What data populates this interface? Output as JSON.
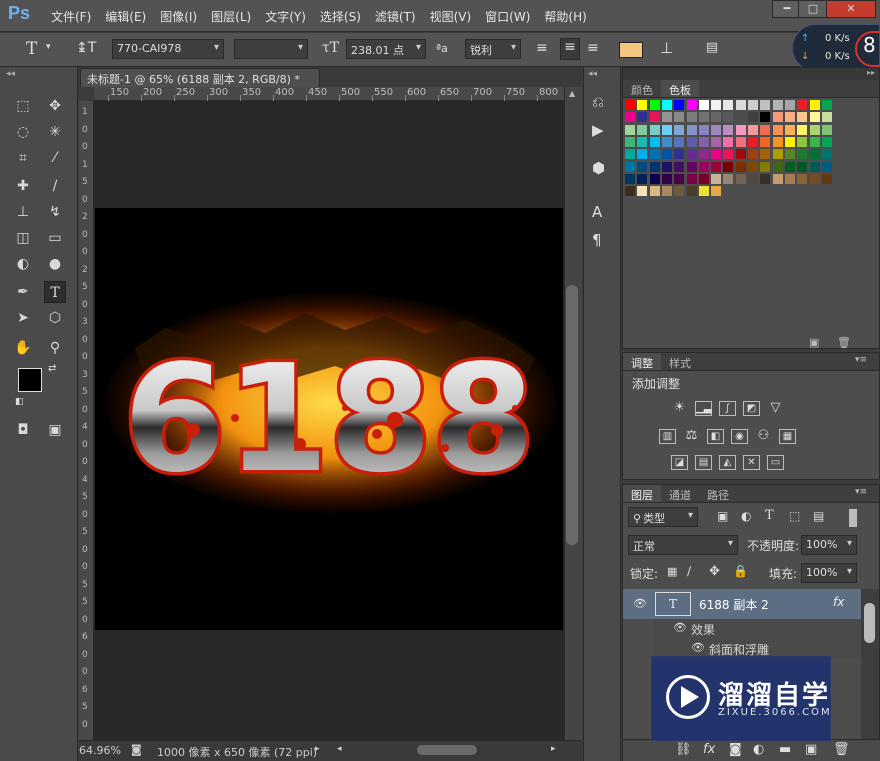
{
  "app": {
    "logo": "Ps"
  },
  "menu": [
    "文件(F)",
    "编辑(E)",
    "图像(I)",
    "图层(L)",
    "文字(Y)",
    "选择(S)",
    "滤镜(T)",
    "视图(V)",
    "窗口(W)",
    "帮助(H)"
  ],
  "window_controls": {
    "minimize": "━",
    "maximize": "□",
    "close": "✕"
  },
  "options_bar": {
    "tool_glyph": "T",
    "font_family": "770-CAI978",
    "font_size": "238.01 点",
    "antialias_glyph": "ªa",
    "antialias": "锐利",
    "swatch_color": "#f5c77e"
  },
  "net_widget": {
    "up": "0 K/s",
    "down": "0 K/s",
    "badge": "8"
  },
  "document": {
    "tab_title": "未标题-1 @ 65% (6188 副本 2, RGB/8) *",
    "close": "×",
    "ruler_h": [
      "150",
      "200",
      "250",
      "300",
      "350",
      "400",
      "450",
      "500",
      "550",
      "600",
      "650",
      "700",
      "750",
      "800"
    ],
    "ruler_v": [
      "1",
      "0",
      "0",
      "1",
      "5",
      "0",
      "2",
      "0",
      "0",
      "2",
      "5",
      "0",
      "3",
      "0",
      "0",
      "3",
      "5",
      "0",
      "4",
      "0",
      "0",
      "4",
      "5",
      "0",
      "5",
      "0",
      "0",
      "5",
      "5",
      "0",
      "6",
      "0",
      "0",
      "6",
      "5",
      "0"
    ],
    "text": "6188",
    "colors": {
      "fire": "#ffb020",
      "ember": "#c81e0a",
      "steel": "#e8e8e8"
    }
  },
  "status": {
    "zoom": "64.96%",
    "info": "1000 像素 x 650 像素 (72 ppi)"
  },
  "swatches_panel": {
    "tabs": [
      "颜色",
      "色板"
    ],
    "active": "色板",
    "rows": [
      [
        "#ff0000",
        "#ffff00",
        "#00ff00",
        "#00ffff",
        "#0000ff",
        "#ff00ff",
        "#ffffff",
        "#f2f2f2",
        "#e6e6e6",
        "#d9d9d9",
        "#cccccc",
        "#bfbfbf",
        "#b3b3b3",
        "#a6a6a6",
        "#ed1c24",
        "#fff200",
        "#00a650"
      ],
      [
        "#ec008c",
        "#2e3192",
        "#ed145b",
        "#949494",
        "#898989",
        "#7d7d7d",
        "#737373",
        "#666666",
        "#595959",
        "#4d4d4d",
        "#404040",
        "#000000",
        "#f7977a",
        "#f9ad81",
        "#fdc68a",
        "#fff79a",
        "#c4df9b"
      ],
      [
        "#a3d39c",
        "#82ca9d",
        "#7bcdc8",
        "#6ecff6",
        "#7ea7d8",
        "#8493ca",
        "#8882be",
        "#a187be",
        "#bc8dbf",
        "#f49ac2",
        "#f6989d",
        "#f26c4f",
        "#f68e55",
        "#fbaf5c",
        "#fff467",
        "#acd372",
        "#7dc473"
      ],
      [
        "#3bb878",
        "#1abbb4",
        "#00bff3",
        "#438ccb",
        "#5574b9",
        "#605ca8",
        "#855fa8",
        "#a763a8",
        "#f06eaa",
        "#f26d7d",
        "#ed1c24",
        "#f26522",
        "#f7941d",
        "#fff200",
        "#8dc73f",
        "#39b54a",
        "#00a651"
      ],
      [
        "#00a99d",
        "#00aeef",
        "#0072bc",
        "#0054a6",
        "#2e3192",
        "#662d91",
        "#92278f",
        "#ec008c",
        "#ed145b",
        "#9e0b0f",
        "#a0410d",
        "#a36209",
        "#aba000",
        "#598527",
        "#1a7b30",
        "#007236",
        "#00746b"
      ],
      [
        "#0076a3",
        "#004a80",
        "#003471",
        "#1b1464",
        "#440e62",
        "#630460",
        "#9e005d",
        "#9e0039",
        "#790000",
        "#7b2e00",
        "#7d4900",
        "#827b00",
        "#406618",
        "#005e20",
        "#005826",
        "#005952",
        "#005b7f"
      ],
      [
        "#003663",
        "#002157",
        "#0d004c",
        "#32004b",
        "#4b0049",
        "#7b0046",
        "#7a0026",
        "#c7b299",
        "#998675",
        "#736357",
        "#534741",
        "#37302a",
        "#c69c6d",
        "#a67c52",
        "#8c6239",
        "#754c24",
        "#603913"
      ],
      [
        "#3c2d1c",
        "#f5e2b8",
        "#d9b883",
        "#a88a5d",
        "#6f5a3b",
        "#4a3c28",
        "#f0e130",
        "#e8a84c"
      ]
    ]
  },
  "adjustments_panel": {
    "tabs": [
      "调整",
      "样式"
    ],
    "active": "调整",
    "title": "添加调整"
  },
  "layers_panel": {
    "tabs": [
      "图层",
      "通道",
      "路径"
    ],
    "active": "图层",
    "filter": "类型",
    "blend_mode": "正常",
    "opacity_label": "不透明度:",
    "opacity": "100%",
    "lock_label": "锁定:",
    "fill_label": "填充:",
    "fill": "100%",
    "layers": [
      {
        "name": "6188 副本 2",
        "thumb": "T",
        "fx": "fx"
      },
      {
        "name": "效果"
      },
      {
        "name": "斜面和浮雕"
      }
    ]
  },
  "watermark": {
    "title": "溜溜自学",
    "subtitle": "ZIXUE.3066.COM"
  }
}
